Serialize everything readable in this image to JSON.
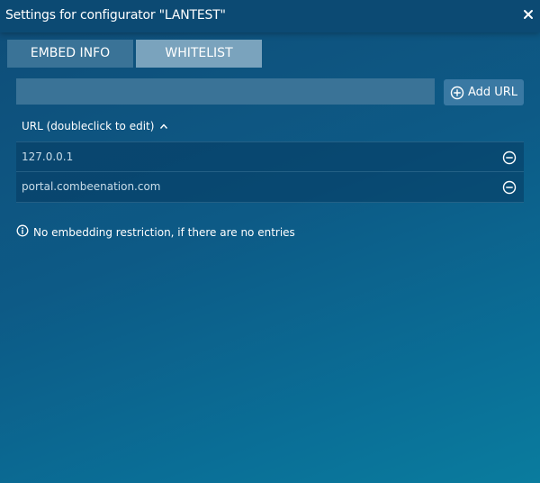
{
  "dialog": {
    "title": "Settings for configurator \"LANTEST\"",
    "close_icon": "close-icon"
  },
  "tabs": [
    {
      "label": "EMBED INFO",
      "active": false
    },
    {
      "label": "WHITELIST",
      "active": true
    }
  ],
  "url_input": {
    "value": "",
    "placeholder": ""
  },
  "add_button": {
    "label": "Add URL",
    "icon": "plus-circle-icon"
  },
  "list": {
    "header": "URL (doubleclick to edit)",
    "sort_icon": "sort-ascending-icon",
    "rows": [
      {
        "url": "127.0.0.1",
        "remove_icon": "minus-circle-icon"
      },
      {
        "url": "portal.combeenation.com",
        "remove_icon": "minus-circle-icon"
      }
    ]
  },
  "info": {
    "icon": "info-icon",
    "text": "No embedding restriction, if there are no entries"
  },
  "colors": {
    "titlebar": "#0c4a73",
    "tab_inactive": "#3a7397",
    "tab_active": "#7aa3bd",
    "button": "#3a79a3"
  }
}
